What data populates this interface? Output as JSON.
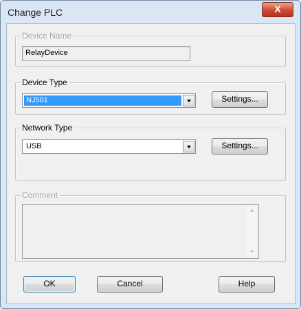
{
  "window": {
    "title": "Change PLC",
    "close_symbol": "X"
  },
  "device_name": {
    "legend": "Device Name",
    "value": "RelayDevice"
  },
  "device_type": {
    "legend": "Device Type",
    "selected": "NJ501",
    "settings_label": "Settings..."
  },
  "network_type": {
    "legend": "Network Type",
    "selected": "USB",
    "settings_label": "Settings..."
  },
  "comment": {
    "legend": "Comment",
    "value": ""
  },
  "buttons": {
    "ok": "OK",
    "cancel": "Cancel",
    "help": "Help"
  },
  "colors": {
    "selection": "#3399ff",
    "close_button": "#cc4a33",
    "frame": "#dbe6f4"
  }
}
